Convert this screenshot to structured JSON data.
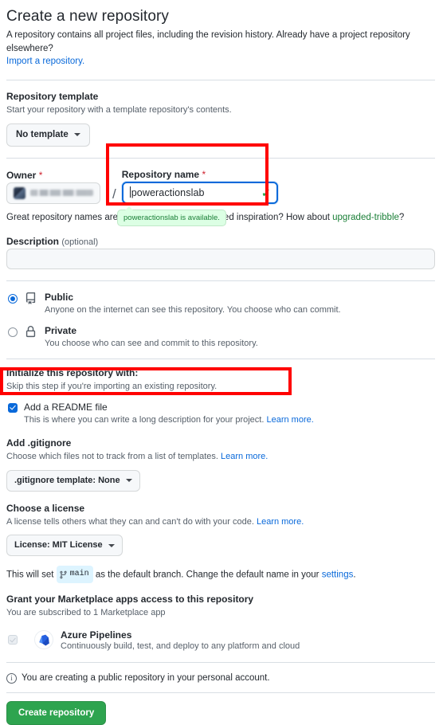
{
  "header": {
    "title": "Create a new repository",
    "subtitle": "A repository contains all project files, including the revision history. Already have a project repository elsewhere?",
    "import_link": "Import a repository."
  },
  "template": {
    "label": "Repository template",
    "note": "Start your repository with a template repository's contents.",
    "button": "No template"
  },
  "owner": {
    "label": "Owner",
    "required_mark": "*",
    "separator": "/"
  },
  "repo_name": {
    "label": "Repository name",
    "required_mark": "*",
    "value": "poweractionslab",
    "valid_icon": "check-icon",
    "availability_tooltip": "poweractionslab is available.",
    "hint_prefix": "Great repository names are ",
    "hint_mid": "short and memorable. Need",
    "hint_suffix": " inspiration? ",
    "hint_suggestion_prefix": "How about ",
    "hint_suggestion": "upgraded-tribble",
    "hint_suggestion_suffix": "?"
  },
  "description": {
    "label": "Description",
    "optional": "(optional)",
    "value": "",
    "placeholder": ""
  },
  "visibility": {
    "public": {
      "title": "Public",
      "desc": "Anyone on the internet can see this repository. You choose who can commit.",
      "selected": true,
      "icon": "repo-icon"
    },
    "private": {
      "title": "Private",
      "desc": "You choose who can see and commit to this repository.",
      "selected": false,
      "icon": "lock-icon"
    }
  },
  "initialize": {
    "label": "Initialize this repository with:",
    "note": "Skip this step if you're importing an existing repository.",
    "readme": {
      "title": "Add a README file",
      "desc": "This is where you can write a long description for your project.",
      "learn_more": "Learn more.",
      "checked": true
    }
  },
  "gitignore": {
    "label": "Add .gitignore",
    "note": "Choose which files not to track from a list of templates.",
    "learn_more": "Learn more.",
    "button": ".gitignore template: None"
  },
  "license": {
    "label": "Choose a license",
    "note": "A license tells others what they can and can't do with your code.",
    "learn_more": "Learn more.",
    "button": "License: MIT License"
  },
  "branch": {
    "prefix": "This will set ",
    "name": "main",
    "icon": "git-branch-icon",
    "middle": " as the default branch. Change the default name in your ",
    "link": "settings",
    "suffix": "."
  },
  "marketplace": {
    "label": "Grant your Marketplace apps access to this repository",
    "note": "You are subscribed to 1 Marketplace app",
    "app": {
      "name": "Azure Pipelines",
      "desc": "Continuously build, test, and deploy to any platform and cloud",
      "icon": "azure-pipelines-icon",
      "checked": true,
      "disabled": true
    }
  },
  "footer": {
    "info_icon": "info-icon",
    "info_text": "You are creating a public repository in your personal account.",
    "create_button": "Create repository"
  },
  "annotations": {
    "color": "#ff0000",
    "boxes": [
      "repository-name-field",
      "add-readme-checkbox"
    ]
  }
}
